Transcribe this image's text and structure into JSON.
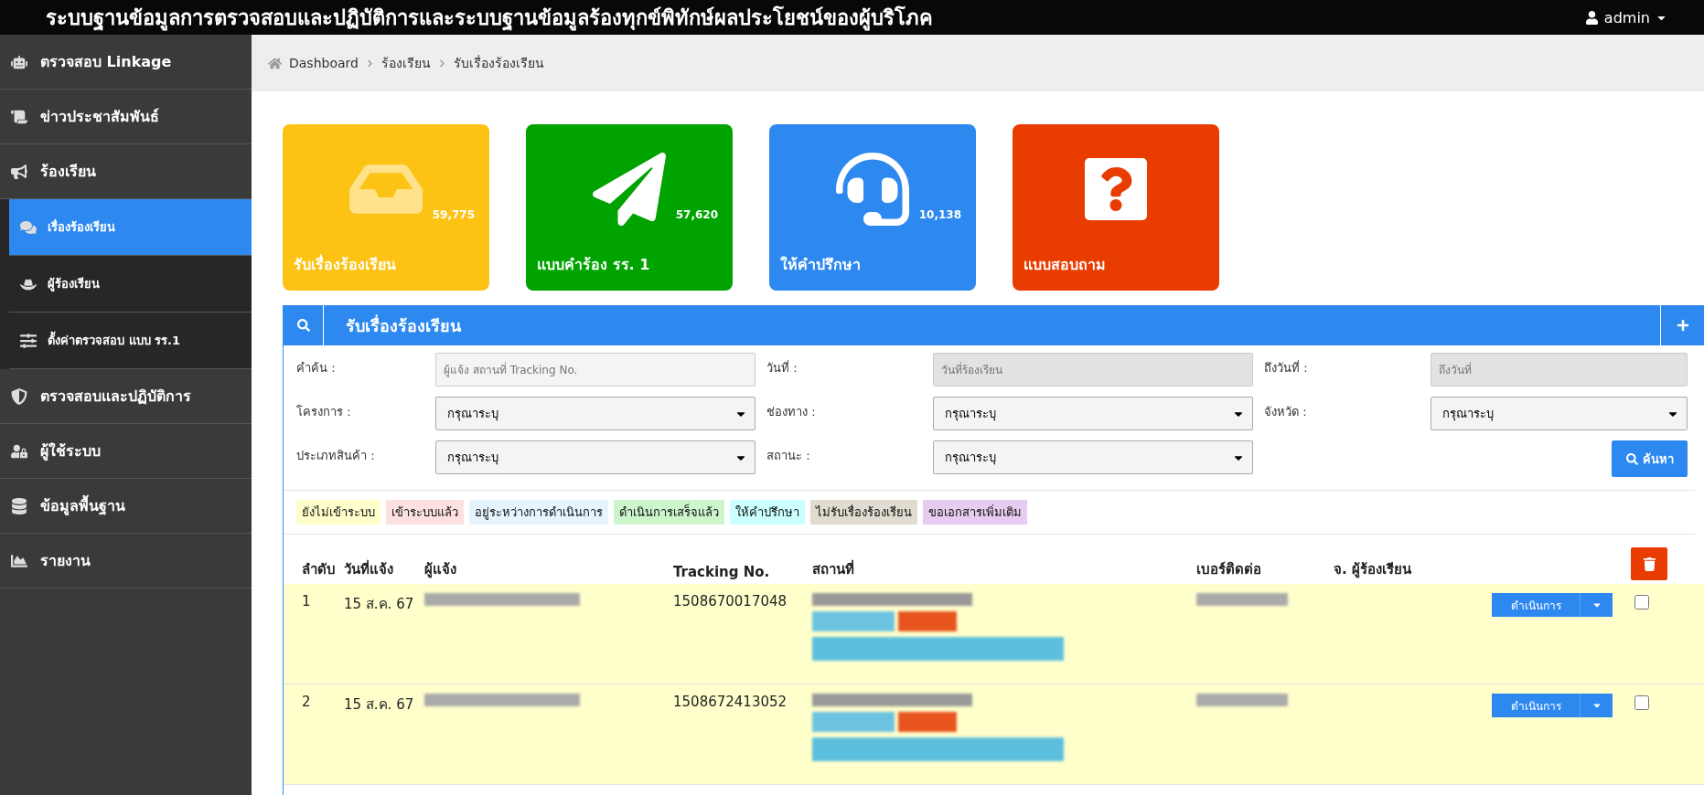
{
  "header": {
    "title": "ระบบฐานข้อมูลการตรวจสอบและปฏิบัติการและระบบฐานข้อมูลร้องทุกข์พิทักษ์ผลประโยชน์ของผู้บริโภค",
    "user": "admin"
  },
  "sidebar": {
    "items": [
      {
        "label": "ตรวจสอบ Linkage",
        "selected": false
      },
      {
        "label": "ข่าวประชาสัมพันธ์",
        "selected": false
      },
      {
        "label": "ร้องเรียน",
        "selected": false,
        "expanded": true,
        "children": [
          {
            "label": "เรื่องร้องเรียน",
            "selected": true
          },
          {
            "label": "ผู้ร้องเรียน",
            "selected": false
          },
          {
            "label": "ตั้งค่าตรวจสอบ แบบ รร.1",
            "selected": false
          }
        ]
      },
      {
        "label": "ตรวจสอบและปฏิบัติการ",
        "selected": false
      },
      {
        "label": "ผู้ใช้ระบบ",
        "selected": false
      },
      {
        "label": "ข้อมูลพื้นฐาน",
        "selected": false
      },
      {
        "label": "รายงาน",
        "selected": false
      }
    ]
  },
  "breadcrumb": [
    "Dashboard",
    "ร้องเรียน",
    "รับเรื่องร้องเรียน"
  ],
  "cards": [
    {
      "label": "รับเรื่องร้องเรียน",
      "count": "59,775",
      "color": "#fdc314"
    },
    {
      "label": "แบบคำร้อง รร. 1",
      "count": "57,620",
      "color": "#00a300"
    },
    {
      "label": "ให้คำปรึกษา",
      "count": "10,138",
      "color": "#2d89ef"
    },
    {
      "label": "แบบสอบถาม",
      "color": "#e83c00"
    }
  ],
  "panel": {
    "title": "รับเรื่องร้องเรียน",
    "filters": [
      {
        "label": "คำค้น :",
        "kind": "text",
        "placeholder": "ผู้แจ้ง สถานที่ Tracking No."
      },
      {
        "label": "วันที่ :",
        "kind": "date",
        "placeholder": "วันที่ร้องเรียน"
      },
      {
        "label": "ถึงวันที่ :",
        "kind": "date",
        "placeholder": "ถึงวันที่"
      },
      {
        "label": "โครงการ :",
        "kind": "select",
        "value": "กรุณาระบุ"
      },
      {
        "label": "ช่องทาง :",
        "kind": "select",
        "value": "กรุณาระบุ"
      },
      {
        "label": "จังหวัด :",
        "kind": "select",
        "value": "กรุณาระบุ"
      },
      {
        "label": "ประเภทสินค้า :",
        "kind": "select",
        "value": "กรุณาระบุ"
      },
      {
        "label": "สถานะ :",
        "kind": "select",
        "value": "กรุณาระบุ"
      }
    ],
    "search_button": "ค้นหา",
    "legend": [
      {
        "label": "ยังไม่เข้าระบบ",
        "color": "#ffffcc"
      },
      {
        "label": "เข้าระบบแล้ว",
        "color": "#fde0e0"
      },
      {
        "label": "อยู่ระหว่างการดำเนินการ",
        "color": "#e6f4fd"
      },
      {
        "label": "ดำเนินการเสร็จแล้ว",
        "color": "#ccf5cc"
      },
      {
        "label": "ให้คำปรึกษา",
        "color": "#ccffff"
      },
      {
        "label": "ไม่รับเรื่องร้องเรียน",
        "color": "#e0dcd0"
      },
      {
        "label": "ขอเอกสารเพิ่มเติม",
        "color": "#e6ccf0"
      }
    ],
    "table": {
      "columns": [
        "ลำดับ",
        "วันที่แจ้ง",
        "ผู้แจ้ง",
        "Tracking No.",
        "สถานที่",
        "เบอร์ติดต่อ",
        "จ. ผู้ร้องเรียน"
      ],
      "rows": [
        {
          "index": "1",
          "date": "15 ส.ค. 67",
          "tracking": "1508670017048",
          "action": "ดำเนินการ",
          "checked": false,
          "color": "#ffffcc"
        },
        {
          "index": "2",
          "date": "15 ส.ค. 67",
          "tracking": "1508672413052",
          "action": "ดำเนินการ",
          "checked": false,
          "color": "#ffffcc"
        }
      ]
    }
  }
}
